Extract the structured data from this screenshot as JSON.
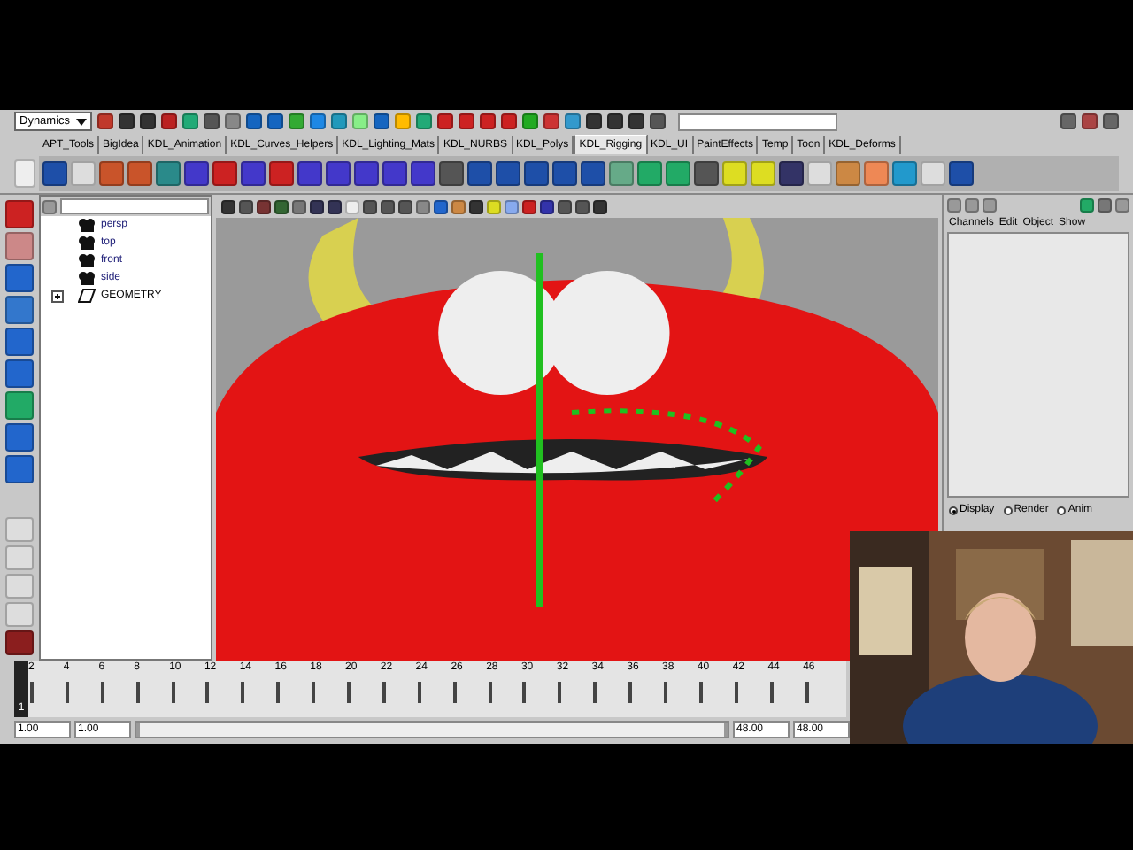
{
  "status_line": {
    "menu_set": "Dynamics"
  },
  "shelf_tabs": [
    {
      "label": "APT_Tools",
      "selected": false
    },
    {
      "label": "BigIdea",
      "selected": false
    },
    {
      "label": "KDL_Animation",
      "selected": false
    },
    {
      "label": "KDL_Curves_Helpers",
      "selected": false
    },
    {
      "label": "KDL_Lighting_Mats",
      "selected": false
    },
    {
      "label": "KDL_NURBS",
      "selected": false
    },
    {
      "label": "KDL_Polys",
      "selected": false
    },
    {
      "label": "KDL_Rigging",
      "selected": true
    },
    {
      "label": "KDL_UI",
      "selected": false
    },
    {
      "label": "PaintEffects",
      "selected": false
    },
    {
      "label": "Temp",
      "selected": false
    },
    {
      "label": "Toon",
      "selected": false
    },
    {
      "label": "KDL_Deforms",
      "selected": false
    }
  ],
  "outliner": {
    "items": [
      {
        "label": "persp",
        "kind": "camera"
      },
      {
        "label": "top",
        "kind": "camera"
      },
      {
        "label": "front",
        "kind": "camera"
      },
      {
        "label": "side",
        "kind": "camera"
      },
      {
        "label": "GEOMETRY",
        "kind": "group",
        "expanded": false
      }
    ]
  },
  "channel_box": {
    "menu": [
      "Channels",
      "Edit",
      "Object",
      "Show"
    ],
    "modes": [
      {
        "label": "Display",
        "selected": true
      },
      {
        "label": "Render",
        "selected": false
      },
      {
        "label": "Anim",
        "selected": false
      }
    ]
  },
  "time_slider": {
    "level": 0,
    "current_frame": "1",
    "ticks": [
      "2",
      "4",
      "6",
      "8",
      "10",
      "12",
      "14",
      "16",
      "18",
      "20",
      "22",
      "24",
      "26",
      "28",
      "30",
      "32",
      "34",
      "36",
      "38",
      "40",
      "42",
      "44",
      "46"
    ]
  },
  "range_slider": {
    "level": 1,
    "start_time": "1.00",
    "playback_start": "1.00",
    "playback_end": "48.00",
    "end_time": "48.00"
  }
}
